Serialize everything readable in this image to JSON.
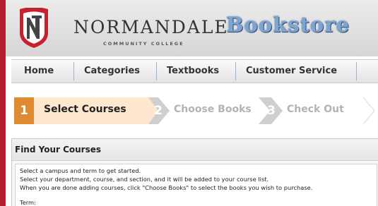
{
  "brand": {
    "name": "NORMANDALE",
    "subtitle": "COMMUNITY COLLEGE",
    "store": "Bookstore"
  },
  "nav": {
    "items": [
      {
        "label": "Home"
      },
      {
        "label": "Categories"
      },
      {
        "label": "Textbooks"
      },
      {
        "label": "Customer Service"
      }
    ]
  },
  "steps": [
    {
      "number": "1",
      "label": "Select Courses"
    },
    {
      "number": "2",
      "label": "Choose Books"
    },
    {
      "number": "3",
      "label": "Check Out"
    }
  ],
  "panel": {
    "title": "Find Your Courses",
    "lines": [
      "Select a campus and term to get started.",
      "Select your department, course, and section, and it will be added to your course list.",
      "When you are done adding courses, click \"Choose Books\" to select the books you wish to purchase."
    ],
    "term_label": "Term:"
  },
  "colors": {
    "background": "#b01f2e",
    "active_step": "#e08a32",
    "active_step_bg": "#fde7cf",
    "inactive_step": "#cfcfcf",
    "store_text": "#7da5d2"
  }
}
